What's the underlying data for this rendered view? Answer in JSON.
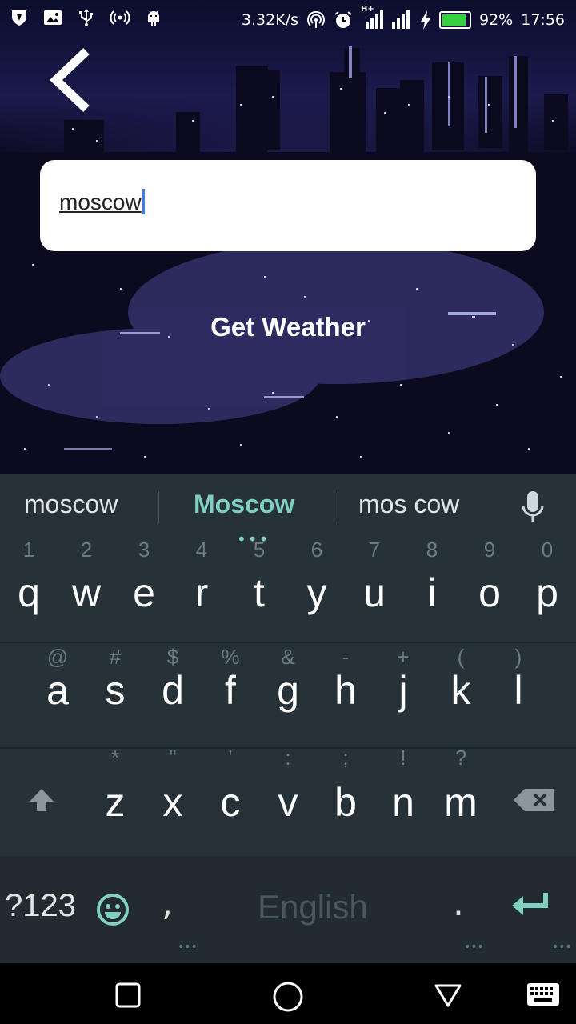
{
  "status_bar": {
    "speed": "3.32K/s",
    "signal_label": "H+",
    "battery": "92%",
    "battery_level": 0.92,
    "time": "17:56"
  },
  "search": {
    "value": "moscow"
  },
  "action": {
    "label": "Get Weather"
  },
  "keyboard": {
    "suggestions": [
      "moscow",
      "Moscow",
      "mos cow"
    ],
    "row1": [
      "q",
      "w",
      "e",
      "r",
      "t",
      "y",
      "u",
      "i",
      "o",
      "p"
    ],
    "row1_hints": [
      "1",
      "2",
      "3",
      "4",
      "5",
      "6",
      "7",
      "8",
      "9",
      "0"
    ],
    "row2": [
      "a",
      "s",
      "d",
      "f",
      "g",
      "h",
      "j",
      "k",
      "l"
    ],
    "row2_hints": [
      "@",
      "#",
      "$",
      "%",
      "&",
      "-",
      "+",
      "(",
      ")"
    ],
    "row3": [
      "z",
      "x",
      "c",
      "v",
      "b",
      "n",
      "m"
    ],
    "row3_hints": [
      "*",
      "\"",
      "'",
      ":",
      ";",
      "!",
      "?"
    ],
    "symbols_label": "?123",
    "comma": ",",
    "space_label": "English",
    "period": "."
  },
  "colors": {
    "accent": "#7fcfc2",
    "keyboard_bg": "#263238",
    "caret": "#3f7de8"
  }
}
